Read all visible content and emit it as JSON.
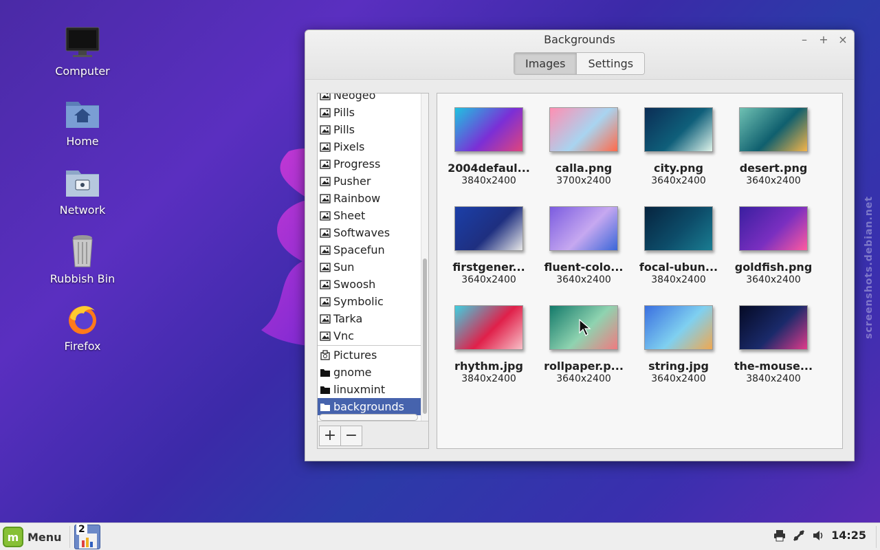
{
  "desktop": {
    "icons": [
      {
        "label": "Computer"
      },
      {
        "label": "Home"
      },
      {
        "label": "Network"
      },
      {
        "label": "Rubbish Bin"
      },
      {
        "label": "Firefox"
      }
    ],
    "watermark": "screenshots.debian.net"
  },
  "window": {
    "title": "Backgrounds",
    "minimize": "–",
    "maximize": "+",
    "close": "×",
    "tabs": [
      {
        "label": "Images",
        "active": true
      },
      {
        "label": "Settings",
        "active": false
      }
    ],
    "sidebar": {
      "themes": [
        "Neogeo",
        "Pills",
        "Pills",
        "Pixels",
        "Progress",
        "Pusher",
        "Rainbow",
        "Sheet",
        "Softwaves",
        "Spacefun",
        "Sun",
        "Swoosh",
        "Symbolic",
        "Tarka",
        "Vnc"
      ],
      "folders": [
        {
          "label": "Pictures",
          "icon": "pictures-folder-icon"
        },
        {
          "label": "gnome",
          "icon": "folder-icon"
        },
        {
          "label": "linuxmint",
          "icon": "folder-icon"
        },
        {
          "label": "backgrounds",
          "icon": "folder-icon",
          "selected": true
        }
      ],
      "add_label": "+",
      "remove_label": "−"
    },
    "images": [
      {
        "name": "2004defaul...",
        "res": "3840x2400",
        "colors": [
          "#1fc3e0",
          "#7b2fd6",
          "#e0457c"
        ]
      },
      {
        "name": "calla.png",
        "res": "3700x2400",
        "colors": [
          "#ff8fb2",
          "#a8d4f0",
          "#ff6a4a"
        ]
      },
      {
        "name": "city.png",
        "res": "3640x2400",
        "colors": [
          "#0b2d55",
          "#0f5f7a",
          "#dff4ea"
        ]
      },
      {
        "name": "desert.png",
        "res": "3640x2400",
        "colors": [
          "#6fc1b3",
          "#0f5f6e",
          "#f4b54a"
        ]
      },
      {
        "name": "firstgener...",
        "res": "3640x2400",
        "colors": [
          "#1b3fa8",
          "#1e2f80",
          "#e8e8e8"
        ]
      },
      {
        "name": "fluent-colo...",
        "res": "3640x2400",
        "colors": [
          "#7b5ce0",
          "#c6a8f0",
          "#3a66d8"
        ]
      },
      {
        "name": "focal-ubun...",
        "res": "3840x2400",
        "colors": [
          "#06243f",
          "#0d4d6a",
          "#1a7d92"
        ]
      },
      {
        "name": "goldfish.png",
        "res": "3640x2400",
        "colors": [
          "#3a1fa0",
          "#7a2fc0",
          "#ff5aa0"
        ]
      },
      {
        "name": "rhythm.jpg",
        "res": "3840x2400",
        "colors": [
          "#3fd0e0",
          "#e0204a",
          "#f7c0c8"
        ]
      },
      {
        "name": "rollpaper.p...",
        "res": "3640x2400",
        "colors": [
          "#137a6a",
          "#8fd3b0",
          "#f07a80"
        ]
      },
      {
        "name": "string.jpg",
        "res": "3640x2400",
        "colors": [
          "#3a6fe0",
          "#7fd0f0",
          "#f0a850"
        ]
      },
      {
        "name": "the-mouse...",
        "res": "3840x2400",
        "colors": [
          "#050a25",
          "#1a2a6a",
          "#e03a8a"
        ]
      }
    ]
  },
  "taskbar": {
    "menu_label": "Menu",
    "workspace_number": "2",
    "clock": "14:25"
  }
}
